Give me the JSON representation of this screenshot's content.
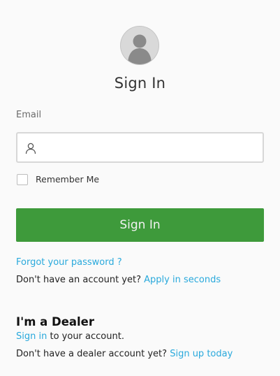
{
  "header": {
    "avatar_icon": "user-avatar-icon",
    "title": "Sign In"
  },
  "form": {
    "email_label": "Email",
    "email_value": "",
    "email_placeholder": "",
    "email_icon": "user-icon",
    "remember_label": "Remember Me",
    "remember_checked": false,
    "submit_label": "Sign In"
  },
  "links": {
    "forgot_password": "Forgot your password ?",
    "no_account_text": "Don't have an account yet?",
    "apply_link": "Apply in seconds"
  },
  "dealer": {
    "heading": "I'm a Dealer",
    "signin_link": "Sign in",
    "signin_suffix": "to your account.",
    "no_account_text": "Don't have a dealer account yet?",
    "signup_link": "Sign up today"
  },
  "colors": {
    "primary_button": "#3e9a3b",
    "link": "#29a9dc",
    "background": "#fafafa"
  }
}
